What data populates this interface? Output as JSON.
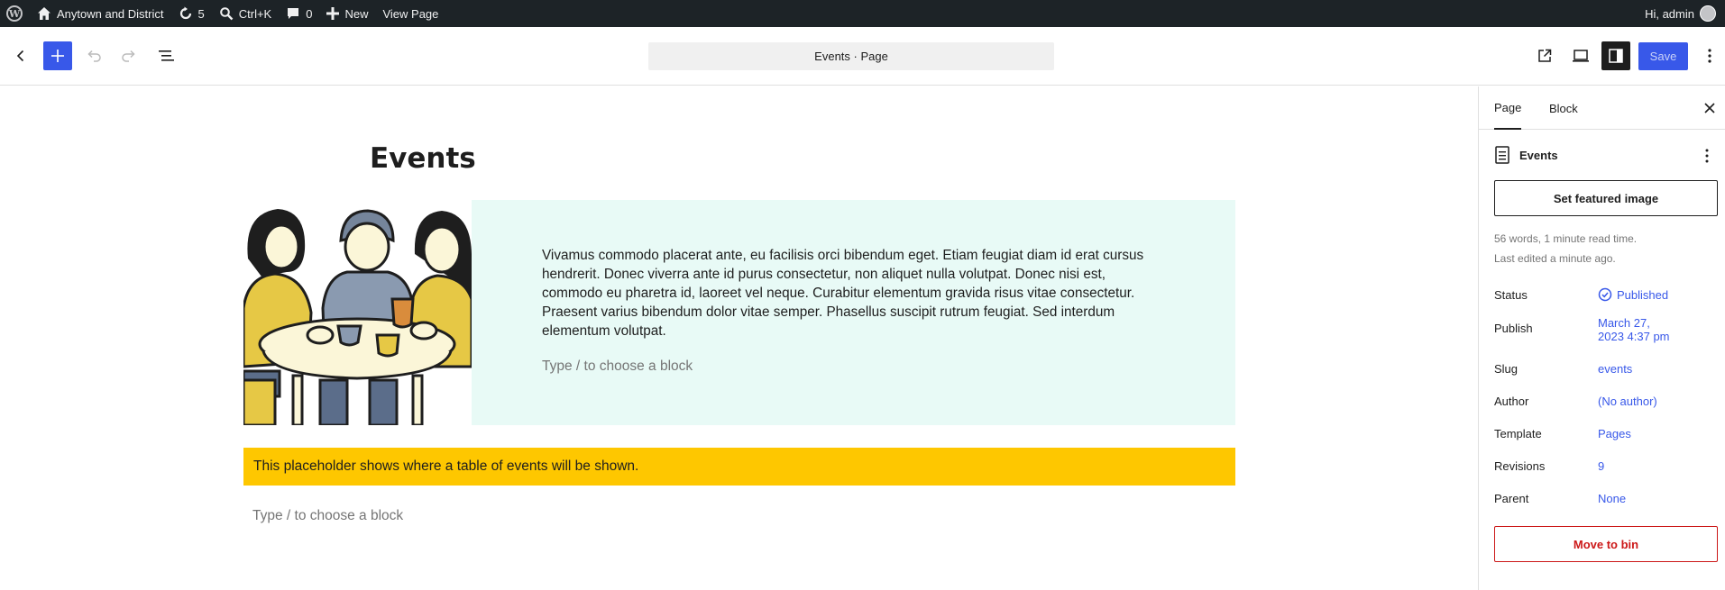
{
  "admin_bar": {
    "site_name": "Anytown and District",
    "updates_count": "5",
    "search_shortcut": "Ctrl+K",
    "comments_count": "0",
    "new_label": "New",
    "view_page_label": "View Page",
    "greeting": "Hi, admin"
  },
  "editor_toolbar": {
    "document_title": "Events · Page",
    "save_label": "Save"
  },
  "canvas": {
    "title": "Events",
    "media_text_paragraph": "Vivamus commodo placerat ante, eu facilisis orci bibendum eget. Etiam feugiat diam id erat cursus hendrerit. Donec viverra ante id purus consectetur, non aliquet nulla volutpat. Donec nisi est, commodo eu pharetra id, laoreet vel neque. Curabitur elementum gravida risus vitae consectetur. Praesent varius bibendum dolor vitae semper. Phasellus suscipit rutrum feugiat. Sed interdum elementum volutpat.",
    "block_placeholder": "Type / to choose a block",
    "notice_text": "This placeholder shows where a table of events will be shown.",
    "colors": {
      "media_bg": "#e8faf6",
      "notice_bg": "#fec700"
    }
  },
  "sidebar": {
    "tabs": [
      "Page",
      "Block"
    ],
    "page_name": "Events",
    "featured_image_label": "Set featured image",
    "word_count": "56 words, 1 minute read time.",
    "last_edited": "Last edited a minute ago.",
    "fields": [
      {
        "label": "Status",
        "value": "Published"
      },
      {
        "label": "Publish",
        "value": "March 27, 2023 4:37 pm"
      },
      {
        "label": "Slug",
        "value": "events"
      },
      {
        "label": "Author",
        "value": "(No author)"
      },
      {
        "label": "Template",
        "value": "Pages"
      },
      {
        "label": "Revisions",
        "value": "9"
      },
      {
        "label": "Parent",
        "value": "None"
      }
    ],
    "move_to_bin_label": "Move to bin",
    "accent_color": "#3858e9",
    "danger_color": "#cc1818"
  }
}
